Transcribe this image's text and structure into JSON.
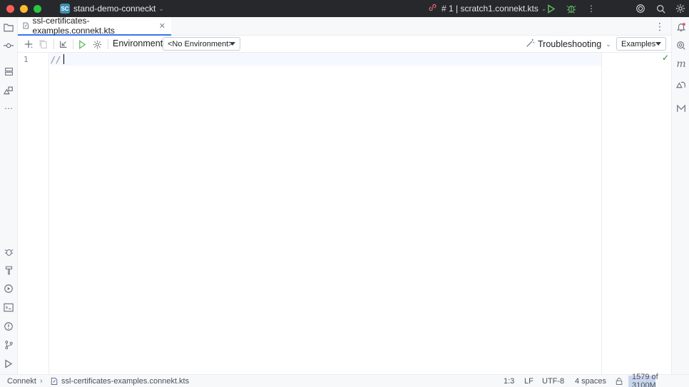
{
  "titlebar": {
    "project_badge": "SC",
    "project_name": "stand-demo-conneckt",
    "run_config": "# 1 | scratch1.connekt.kts"
  },
  "tabs": [
    {
      "label": "ssl-certificates-examples.connekt.kts",
      "active": true
    }
  ],
  "toolbar": {
    "environment_label": "Environment:",
    "environment_value": "<No Environment>",
    "troubleshooting_label": "Troubleshooting",
    "examples_label": "Examples"
  },
  "editor": {
    "lines": [
      {
        "number": "1",
        "text": "//"
      }
    ]
  },
  "statusbar": {
    "breadcrumb_project": "Connekt",
    "breadcrumb_file": "ssl-certificates-examples.connekt.kts",
    "position": "1:3",
    "line_ending": "LF",
    "encoding": "UTF-8",
    "indent": "4 spaces",
    "memory": "1579 of 3100M",
    "memory_fraction": 0.51
  },
  "colors": {
    "accent": "#3574f0",
    "titlebar_bg": "#27282c",
    "check": "#208a3c"
  }
}
